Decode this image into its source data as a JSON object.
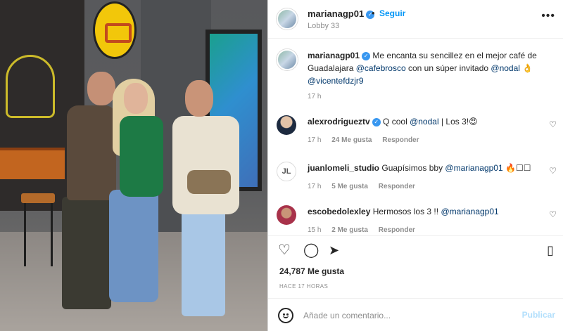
{
  "header": {
    "username": "marianagp01",
    "separator": "•",
    "follow_label": "Seguir",
    "location": "Lobby 33",
    "more_label": "•••"
  },
  "caption": {
    "username": "marianagp01",
    "text_1": "Me encanta su sencillez en el mejor café de Guadalajara",
    "mention_1": "@cafebrosco",
    "text_2": "con un súper invitado",
    "mention_2": "@nodal",
    "emoji_1": "👌",
    "mention_3": "@vicentefdzjr9",
    "time": "17 h"
  },
  "comments": [
    {
      "username": "alexrodrigueztv",
      "text_1": "Q cool",
      "mention": "@nodal",
      "text_2": "| Los 3!",
      "emoji": "😍",
      "time": "17 h",
      "likes": "24 Me gusta",
      "reply": "Responder"
    },
    {
      "username": "juanlomeli_studio",
      "avatar_text": "JL",
      "text_1": "Guapísimos bby",
      "mention": "@marianagp01",
      "emoji": "🔥☐☐",
      "time": "17 h",
      "likes": "5 Me gusta",
      "reply": "Responder"
    },
    {
      "username": "escobedolexley",
      "text_1": "Hermosos los 3 !!",
      "mention": "@marianagp01",
      "time": "15 h",
      "likes": "2 Me gusta",
      "reply": "Responder"
    }
  ],
  "actions": {
    "like_icon": "heart-icon",
    "comment_icon": "comment-icon",
    "share_icon": "share-icon",
    "save_icon": "bookmark-icon"
  },
  "likes_count": "24,787 Me gusta",
  "posted_time": "HACE 17 HORAS",
  "add_comment": {
    "placeholder": "Añade un comentario...",
    "publish_label": "Publicar"
  },
  "colors": {
    "link_blue": "#0095f6",
    "mention_blue": "#00376b",
    "verified_blue": "#3897f0",
    "muted_gray": "#8e8e8e"
  }
}
